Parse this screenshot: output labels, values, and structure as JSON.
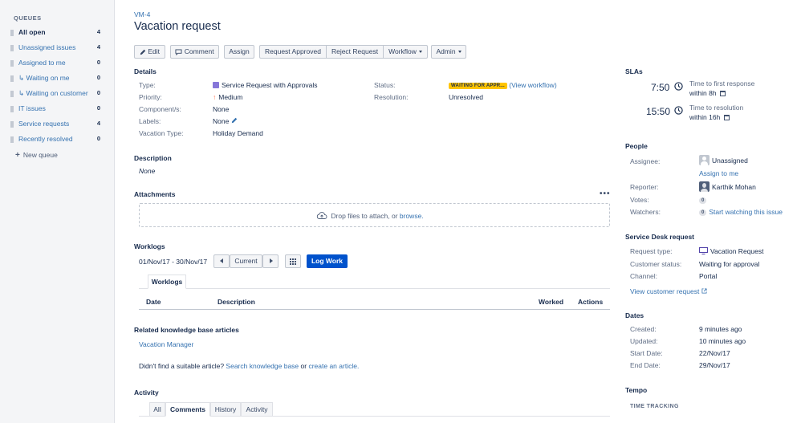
{
  "sidebar": {
    "heading": "QUEUES",
    "items": [
      {
        "label": "All open",
        "count": "4"
      },
      {
        "label": "Unassigned issues",
        "count": "4"
      },
      {
        "label": "Assigned to me",
        "count": "0"
      },
      {
        "label": "↳ Waiting on me",
        "count": "0"
      },
      {
        "label": "↳ Waiting on customer",
        "count": "0"
      },
      {
        "label": "IT issues",
        "count": "0"
      },
      {
        "label": "Service requests",
        "count": "4"
      },
      {
        "label": "Recently resolved",
        "count": "0"
      }
    ],
    "new_queue": "New queue"
  },
  "issue": {
    "key": "VM-4",
    "title": "Vacation request"
  },
  "toolbar": {
    "edit": "Edit",
    "comment": "Comment",
    "assign": "Assign",
    "request_approved": "Request Approved",
    "reject_request": "Reject Request",
    "workflow": "Workflow",
    "admin": "Admin"
  },
  "details": {
    "heading": "Details",
    "type_label": "Type:",
    "type_value": "Service Request with Approvals",
    "priority_label": "Priority:",
    "priority_value": "Medium",
    "component_label": "Component/s:",
    "component_value": "None",
    "labels_label": "Labels:",
    "labels_value": "None",
    "vacation_label": "Vacation Type:",
    "vacation_value": "Holiday Demand",
    "status_label": "Status:",
    "status_value": "WAITING FOR APPR...",
    "view_workflow": "(View workflow)",
    "resolution_label": "Resolution:",
    "resolution_value": "Unresolved"
  },
  "description": {
    "heading": "Description",
    "value": "None"
  },
  "attachments": {
    "heading": "Attachments",
    "drop_text": "Drop files to attach, or ",
    "browse": "browse."
  },
  "worklogs": {
    "heading": "Worklogs",
    "range": "01/Nov/17 - 30/Nov/17",
    "current": "Current",
    "log_work": "Log Work",
    "tab": "Worklogs",
    "columns": [
      "Date",
      "Description",
      "Worked",
      "Actions"
    ]
  },
  "kb": {
    "heading": "Related knowledge base articles",
    "article": "Vacation Manager",
    "prompt": "Didn't find a suitable article?",
    "search": "Search knowledge base",
    "or": "or",
    "create": "create an article."
  },
  "activity": {
    "heading": "Activity",
    "tabs": [
      "All",
      "Comments",
      "History",
      "Activity"
    ],
    "selected": "Comments"
  },
  "slas": {
    "heading": "SLAs",
    "items": [
      {
        "time": "7:50",
        "name": "Time to first response",
        "within": "within 8h"
      },
      {
        "time": "15:50",
        "name": "Time to resolution",
        "within": "within 16h"
      }
    ]
  },
  "people": {
    "heading": "People",
    "assignee_label": "Assignee:",
    "assignee_value": "Unassigned",
    "assign_to_me": "Assign to me",
    "reporter_label": "Reporter:",
    "reporter_value": "Karthik Mohan",
    "votes_label": "Votes:",
    "votes_value": "0",
    "watchers_label": "Watchers:",
    "watchers_value": "0",
    "start_watching": "Start watching this issue"
  },
  "service_desk": {
    "heading": "Service Desk request",
    "request_type_label": "Request type:",
    "request_type_value": "Vacation Request",
    "customer_status_label": "Customer status:",
    "customer_status_value": "Waiting for approval",
    "channel_label": "Channel:",
    "channel_value": "Portal",
    "view_customer_request": "View customer request"
  },
  "dates": {
    "heading": "Dates",
    "created_label": "Created:",
    "created_value": "9 minutes ago",
    "updated_label": "Updated:",
    "updated_value": "10 minutes ago",
    "start_label": "Start Date:",
    "start_value": "22/Nov/17",
    "end_label": "End Date:",
    "end_value": "29/Nov/17"
  },
  "tempo": {
    "heading": "Tempo",
    "time_tracking": "TIME TRACKING"
  },
  "colors": {
    "link": "#3572b0",
    "primary": "#0052cc",
    "lozenge": "#ffc400"
  }
}
